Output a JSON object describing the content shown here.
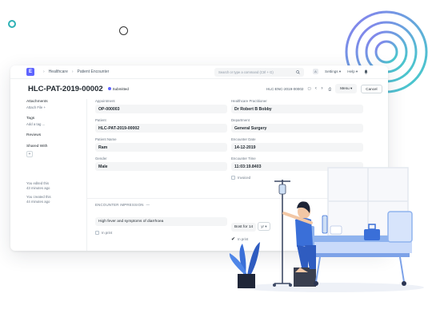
{
  "navbar": {
    "logo_letter": "E",
    "breadcrumb": [
      "Healthcare",
      "Patient Encounter"
    ],
    "search_placeholder": "Search or type a command (Ctrl + G)",
    "settings_label": "Settings",
    "help_label": "Help",
    "avatar_letter": "A"
  },
  "titlebar": {
    "title": "HLC-PAT-2019-00002",
    "status": "Submitted",
    "doc_name": "HLC-ENC-2019-00002",
    "menu_label": "Menu",
    "cancel_label": "Cancel"
  },
  "sidebar": {
    "attachments": "Attachments",
    "attach_file": "Attach File",
    "tags": "Tags",
    "add_tag": "Add a tag ...",
    "reviews": "Reviews",
    "shared_with": "Shared With",
    "activity": [
      "You edited this",
      "43 minutes ago",
      "You created this",
      "44 minutes ago"
    ]
  },
  "fields_left": [
    {
      "label": "Appointment",
      "value": "OP-000003"
    },
    {
      "label": "Patient",
      "value": "HLC-PAT-2019-00002"
    },
    {
      "label": "Patient Name",
      "value": "Ram"
    },
    {
      "label": "Gender",
      "value": "Male"
    }
  ],
  "fields_right": [
    {
      "label": "Healthcare Practitioner",
      "value": "Dr Robert B Bobby"
    },
    {
      "label": "Department",
      "value": "General Surgery"
    },
    {
      "label": "Encounter Date",
      "value": "14-12-2019"
    },
    {
      "label": "Encounter Time",
      "value": "11:03:19.8403"
    }
  ],
  "invoiced_label": "Invoiced",
  "encounter": {
    "section_title": "ENCOUNTER IMPRESSION",
    "impression": "High fever and symptoms of diarrhoea",
    "in_print": "In print",
    "duration_value": "Bost for 14",
    "duration_unit": "yr",
    "in_print_right": "In print"
  },
  "colors": {
    "accent": "#5e64ff",
    "teal": "#2eb1b5",
    "patient_blue": "#3a6fd8",
    "bed_blue": "#8fb3ee"
  }
}
